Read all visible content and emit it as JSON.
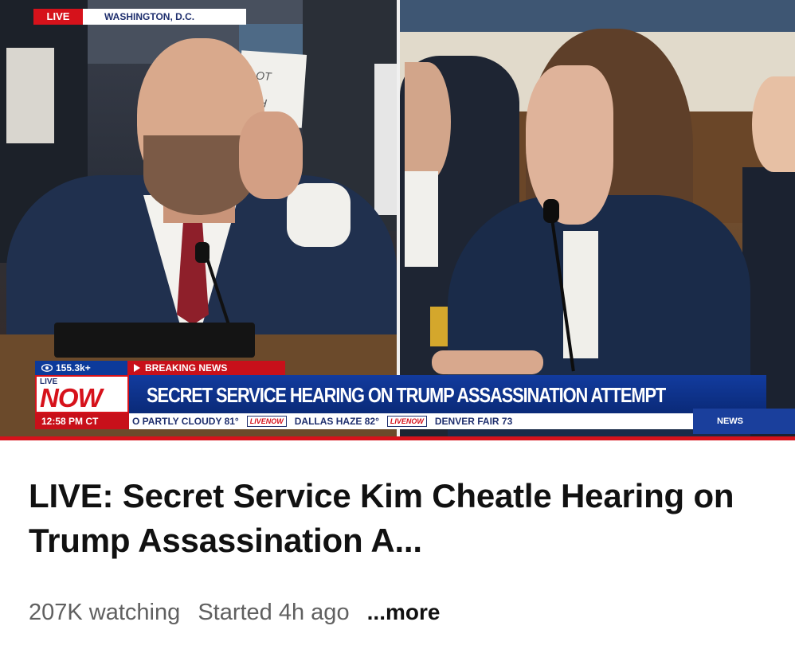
{
  "video": {
    "top_bug": {
      "live": "LIVE",
      "location": "WASHINGTON, D.C."
    },
    "left_sign": {
      "line1": "OT",
      "line2": "H"
    },
    "chyron": {
      "views": "155.3k+",
      "breaking": "BREAKING NEWS",
      "live_label": "LIVE",
      "now_label": "NOW",
      "headline": "SECRET SERVICE HEARING ON TRUMP ASSASSINATION ATTEMPT",
      "time": "12:58 PM CT",
      "ticker": [
        {
          "text": "O PARTLY CLOUDY 81°"
        },
        {
          "logo": "LIVENOW"
        },
        {
          "text": "DALLAS HAZE 82°"
        },
        {
          "logo": "LIVENOW"
        },
        {
          "text": "DENVER FAIR 73"
        }
      ],
      "news_tag": "NEWS"
    },
    "colors": {
      "red": "#d6121b",
      "blue": "#0c3a9a",
      "navy": "#1f2f6e"
    }
  },
  "info": {
    "title": "LIVE: Secret Service Kim Cheatle Hearing on Trump Assassination A...",
    "watching": "207K watching",
    "started": "Started 4h ago",
    "more": "...more"
  }
}
